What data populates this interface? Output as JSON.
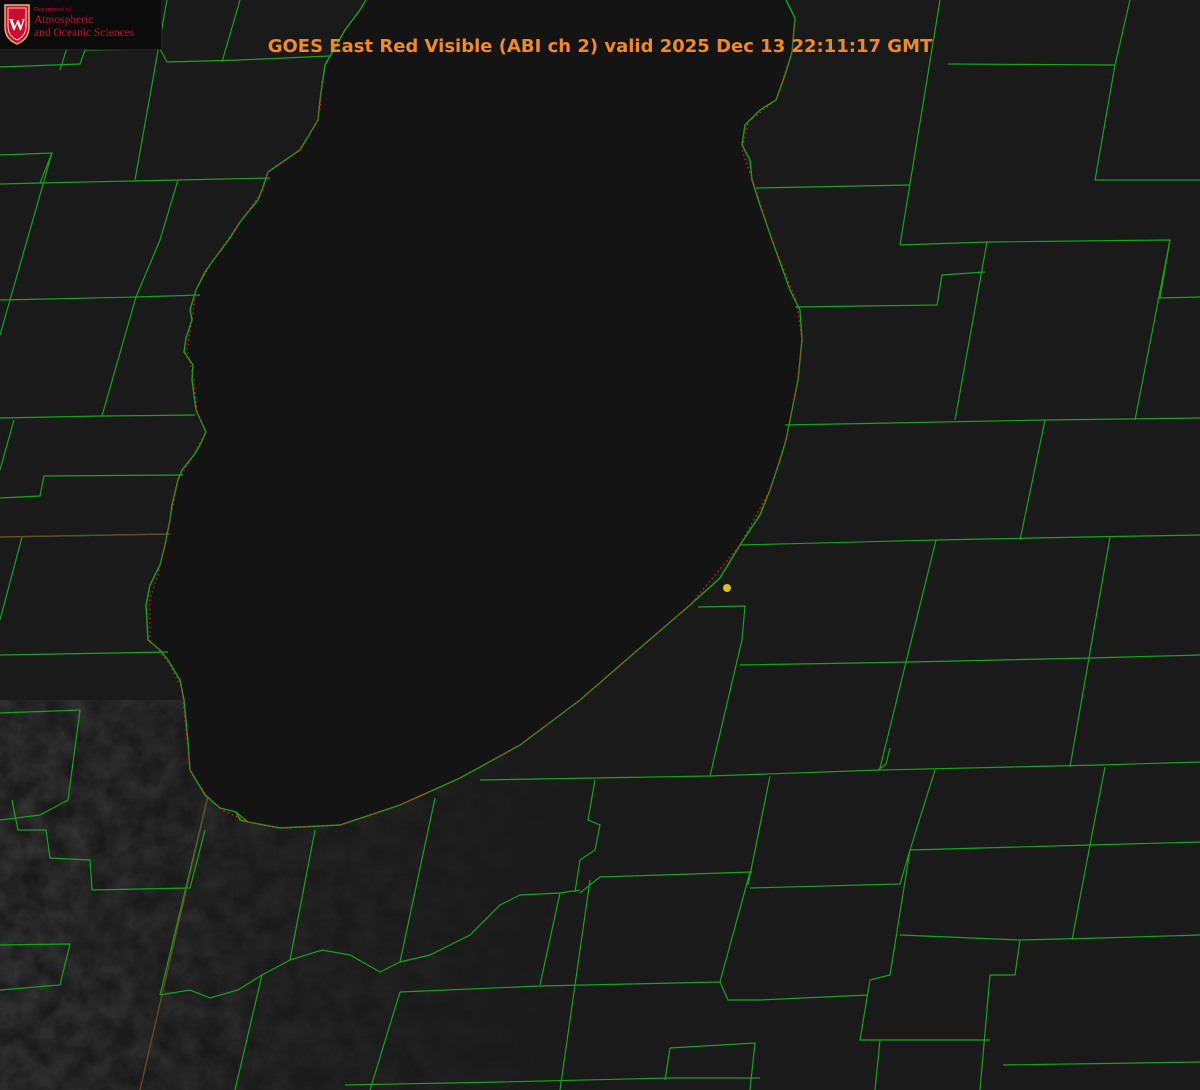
{
  "title": "GOES East Red Visible (ABI ch 2) valid 2025 Dec 13 22:11:17 GMT",
  "logo": {
    "dept": "Department of",
    "line1": "Atmospheric",
    "line2": "and Oceanic Sciences",
    "emblem_letter": "W"
  },
  "colors": {
    "background": "#161616",
    "county_lines": "#16a41c",
    "coastline_dots": "#e0201c",
    "title": "#f0892a",
    "logo": "#c8102e",
    "marker": "#d8c020"
  }
}
